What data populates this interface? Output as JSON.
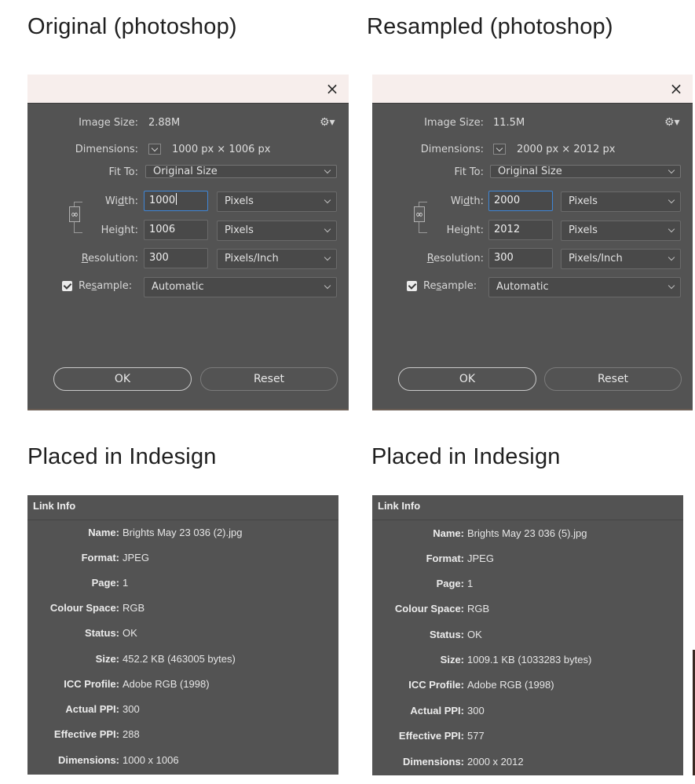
{
  "headings": {
    "original": "Original (photoshop)",
    "resampled": "Resampled (photoshop)",
    "placed_left": "Placed in Indesign",
    "placed_right": "Placed in Indesign"
  },
  "dialogs": [
    {
      "close": "×",
      "image_size_label": "Image Size:",
      "image_size_value": "2.88M",
      "dimensions_label": "Dimensions:",
      "dimensions_value": "1000 px  ×  1006 px",
      "fit_to_label": "Fit To:",
      "fit_to_value": "Original Size",
      "width_label_pre": "Wi",
      "width_label_u": "d",
      "width_label_post": "th:",
      "width_value": "1000",
      "width_unit": "Pixels",
      "height_label_pre": "Hei",
      "height_label_u": "g",
      "height_label_post": "ht:",
      "height_value": "1006",
      "height_unit": "Pixels",
      "resolution_label_u": "R",
      "resolution_label_post": "esolution:",
      "resolution_value": "300",
      "resolution_unit": "Pixels/Inch",
      "resample_label_pre": "Re",
      "resample_label_u": "s",
      "resample_label_post": "ample:",
      "resample_value": "Automatic",
      "ok_label": "OK",
      "reset_label": "Reset"
    },
    {
      "close": "×",
      "image_size_label": "Image Size:",
      "image_size_value": "11.5M",
      "dimensions_label": "Dimensions:",
      "dimensions_value": "2000 px  ×  2012 px",
      "fit_to_label": "Fit To:",
      "fit_to_value": "Original Size",
      "width_label_pre": "Wi",
      "width_label_u": "d",
      "width_label_post": "th:",
      "width_value": "2000",
      "width_unit": "Pixels",
      "height_label_pre": "Hei",
      "height_label_u": "g",
      "height_label_post": "ht:",
      "height_value": "2012",
      "height_unit": "Pixels",
      "resolution_label_u": "R",
      "resolution_label_post": "esolution:",
      "resolution_value": "300",
      "resolution_unit": "Pixels/Inch",
      "resample_label_pre": "Re",
      "resample_label_u": "s",
      "resample_label_post": "ample:",
      "resample_value": "Automatic",
      "ok_label": "OK",
      "reset_label": "Reset"
    }
  ],
  "link_info": [
    {
      "title": "Link Info",
      "rows": [
        {
          "label": "Name:",
          "value": "Brights May 23 036 (2).jpg"
        },
        {
          "label": "Format:",
          "value": "JPEG"
        },
        {
          "label": "Page:",
          "value": "1"
        },
        {
          "label": "Colour Space:",
          "value": "RGB"
        },
        {
          "label": "Status:",
          "value": "OK"
        },
        {
          "label": "Size:",
          "value": "452.2 KB (463005 bytes)"
        },
        {
          "label": "ICC Profile:",
          "value": "Adobe RGB (1998)"
        },
        {
          "label": "Actual PPI:",
          "value": "300"
        },
        {
          "label": "Effective PPI:",
          "value": "288"
        },
        {
          "label": "Dimensions:",
          "value": "1000 x 1006"
        }
      ]
    },
    {
      "title": "Link Info",
      "rows": [
        {
          "label": "Name:",
          "value": "Brights May 23 036 (5).jpg"
        },
        {
          "label": "Format:",
          "value": "JPEG"
        },
        {
          "label": "Page:",
          "value": "1"
        },
        {
          "label": "Colour Space:",
          "value": "RGB"
        },
        {
          "label": "Status:",
          "value": "OK"
        },
        {
          "label": "Size:",
          "value": "1009.1 KB (1033283 bytes)"
        },
        {
          "label": "ICC Profile:",
          "value": "Adobe RGB (1998)"
        },
        {
          "label": "Actual PPI:",
          "value": "300"
        },
        {
          "label": "Effective PPI:",
          "value": "577"
        },
        {
          "label": "Dimensions:",
          "value": "2000 x 2012"
        }
      ]
    }
  ],
  "icons": {
    "close": "close-icon",
    "gear": "gear-icon",
    "chain": "link-chain-icon",
    "checkbox": "checkbox-checked-icon"
  },
  "colors": {
    "dialog_bg": "#535353",
    "titlebar_bg": "#f7eeec",
    "focus_border": "#3f86d6"
  }
}
